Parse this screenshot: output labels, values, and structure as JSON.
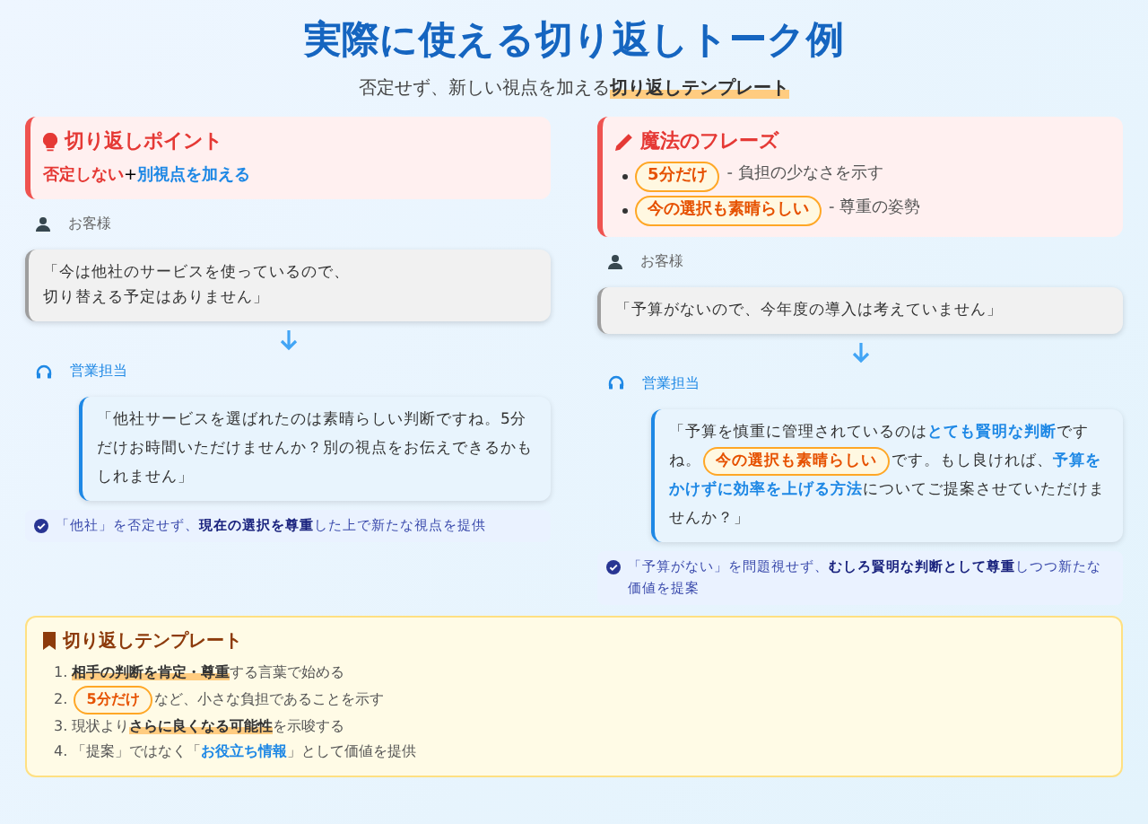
{
  "title": "実際に使える切り返しトーク例",
  "subtitle": [
    {
      "kind": "plain",
      "text": "否定せず、新しい視点を加える"
    },
    {
      "kind": "marker",
      "text": "切り返しテンプレート"
    }
  ],
  "columns": [
    {
      "card": {
        "kind": "point",
        "title": "切り返しポイント",
        "body": [
          {
            "kind": "red",
            "text": "否定しない"
          },
          {
            "kind": "plain",
            "text": "+"
          },
          {
            "kind": "blue",
            "text": "別視点を加える"
          }
        ]
      },
      "customer": {
        "label": "お客様",
        "quote": [
          "「今は他社のサービスを使っているので、",
          "切り替える予定はありません」"
        ]
      },
      "agent": {
        "label": "営業担当",
        "quote": [
          {
            "kind": "plain",
            "text": "「他社サービスを選ばれたのは素晴らしい判断ですね。5分だけお時間いただけませんか？別の視点をお伝えできるかもしれません」"
          }
        ]
      },
      "note": [
        {
          "kind": "plain",
          "text": "「他社」を否定せず、"
        },
        {
          "kind": "strong",
          "text": "現在の選択を尊重"
        },
        {
          "kind": "plain",
          "text": "した上で新たな視点を提供"
        }
      ]
    },
    {
      "card": {
        "kind": "phrases",
        "title": "魔法のフレーズ",
        "items": [
          {
            "phrase": "5分だけ",
            "note": "- 負担の少なさを示す"
          },
          {
            "phrase": "今の選択も素晴らしい",
            "note": "- 尊重の姿勢"
          }
        ]
      },
      "customer": {
        "label": "お客様",
        "quote": [
          "「予算がないので、今年度の導入は考えていません」"
        ]
      },
      "agent": {
        "label": "営業担当",
        "quote": [
          {
            "kind": "plain",
            "text": "「予算を慎重に管理されているのは"
          },
          {
            "kind": "blue",
            "text": "とても賢明な判断"
          },
          {
            "kind": "plain",
            "text": "ですね。"
          },
          {
            "kind": "pill",
            "text": "今の選択も素晴らしい"
          },
          {
            "kind": "plain",
            "text": "です。もし良ければ、"
          },
          {
            "kind": "blue",
            "text": "予算をかけずに効率を上げる方法"
          },
          {
            "kind": "plain",
            "text": "についてご提案させていただけませんか？」"
          }
        ]
      },
      "note": [
        {
          "kind": "plain",
          "text": "「予算がない」を問題視せず、"
        },
        {
          "kind": "strong",
          "text": "むしろ賢明な判断として尊重"
        },
        {
          "kind": "plain",
          "text": "しつつ新たな価値を提案"
        }
      ]
    }
  ],
  "template": {
    "title": "切り返しテンプレート",
    "steps": [
      {
        "number": "1.",
        "parts": [
          {
            "kind": "marker",
            "text": "相手の判断を肯定・尊重"
          },
          {
            "kind": "plain",
            "text": "する言葉で始める"
          }
        ]
      },
      {
        "number": "2.",
        "parts": [
          {
            "kind": "pill",
            "text": "5分だけ"
          },
          {
            "kind": "plain",
            "text": "など、小さな負担であることを示す"
          }
        ]
      },
      {
        "number": "3.",
        "parts": [
          {
            "kind": "plain",
            "text": "現状より"
          },
          {
            "kind": "marker",
            "text": "さらに良くなる可能性"
          },
          {
            "kind": "plain",
            "text": "を示唆する"
          }
        ]
      },
      {
        "number": "4.",
        "parts": [
          {
            "kind": "plain",
            "text": "「提案」ではなく「"
          },
          {
            "kind": "blue",
            "text": "お役立ち情報"
          },
          {
            "kind": "plain",
            "text": "」として価値を提供"
          }
        ]
      }
    ]
  }
}
